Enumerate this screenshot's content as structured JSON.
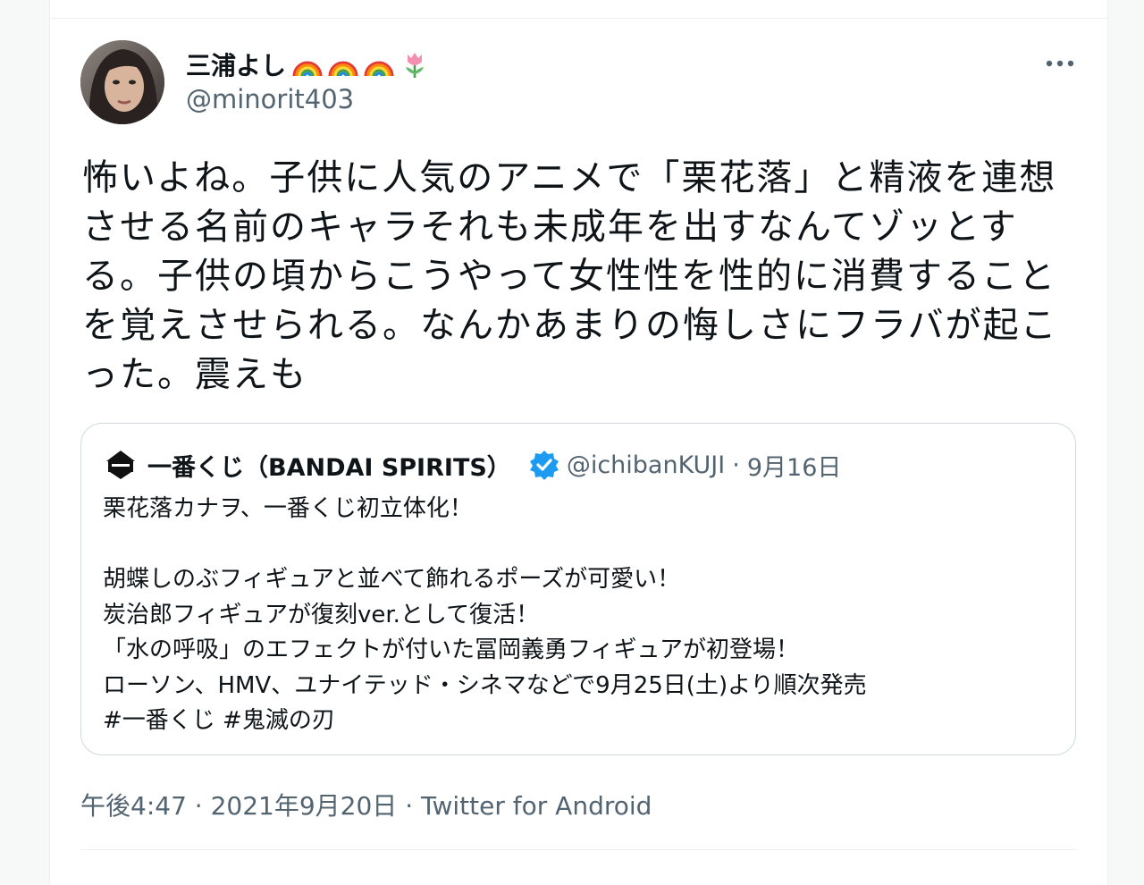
{
  "tweet": {
    "display_name": "三浦よし",
    "name_emojis": [
      "rainbow-icon",
      "rainbow-icon",
      "rainbow-icon",
      "tulip-icon"
    ],
    "handle": "@minorit403",
    "text_lines": [
      "怖いよね。子供に人気のアニメで「栗花落」と精液を連想",
      "させる名前のキャラそれも未成年を出すなんてゾッとす",
      "る。子供の頃からこうやって女性性を性的に消費すること",
      "を覚えさせられる。なんかあまりの悔しさにフラバが起こ",
      "った。震えも"
    ],
    "time": "午後4:47",
    "separator": "·",
    "date": "2021年9月20日",
    "source": "Twitter for Android"
  },
  "quoted": {
    "name": "一番くじ（BANDAI SPIRITS）",
    "verified": true,
    "handle": "@ichibanKUJI",
    "separator": "·",
    "date": "9月16日",
    "lines": [
      "栗花落カナヲ、一番くじ初立体化！",
      "",
      "胡蝶しのぶフィギュアと並べて飾れるポーズが可愛い！",
      "炭治郎フィギュアが復刻ver.として復活！",
      "「水の呼吸」のエフェクトが付いた冨岡義勇フィギュアが初登場！",
      "ローソン、HMV、ユナイテッド・シネマなどで9月25日(土)より順次発売",
      "#一番くじ #鬼滅の刃"
    ]
  },
  "colors": {
    "text": "#0f1419",
    "secondary": "#536471",
    "border": "#cfd9de",
    "verified": "#1d9bf0"
  }
}
